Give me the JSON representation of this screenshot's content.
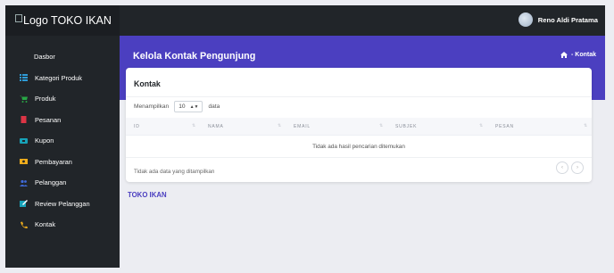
{
  "logo": {
    "alt": "Logo TOKO IKAN"
  },
  "sidebar": {
    "items": [
      {
        "label": "Dasbor",
        "icon": "none"
      },
      {
        "label": "Kategori Produk",
        "icon": "list-icon",
        "color": "#2e9bd6"
      },
      {
        "label": "Produk",
        "icon": "cart-icon",
        "color": "#28a745"
      },
      {
        "label": "Pesanan",
        "icon": "receipt-icon",
        "color": "#dc3545"
      },
      {
        "label": "Kupon",
        "icon": "ticket-icon",
        "color": "#17a2b8"
      },
      {
        "label": "Pembayaran",
        "icon": "money-icon",
        "color": "#f0ad1c"
      },
      {
        "label": "Pelanggan",
        "icon": "users-icon",
        "color": "#3f6ad8"
      },
      {
        "label": "Review Pelanggan",
        "icon": "edit-icon",
        "color": "#17a2b8"
      },
      {
        "label": "Kontak",
        "icon": "phone-icon",
        "color": "#f0ad1c"
      }
    ]
  },
  "topbar": {
    "user_name": "Reno Aldi Pratama"
  },
  "banner": {
    "title": "Kelola Kontak Pengunjung",
    "breadcrumb": "- Kontak"
  },
  "card": {
    "title": "Kontak",
    "show_prefix": "Menampilkan",
    "page_length": "10",
    "show_suffix": "data",
    "columns": [
      "ID",
      "NAMA",
      "EMAIL",
      "SUBJEK",
      "PESAN"
    ],
    "empty_message": "Tidak ada hasil pencarian ditemukan",
    "info": "Tidak ada data yang ditampilkan",
    "prev_label": "‹",
    "next_label": "›"
  },
  "footer": {
    "text": "TOKO IKAN"
  },
  "colors": {
    "accent": "#4b3fc0",
    "sidebar_bg": "#212529",
    "page_bg": "#ecedf2"
  }
}
